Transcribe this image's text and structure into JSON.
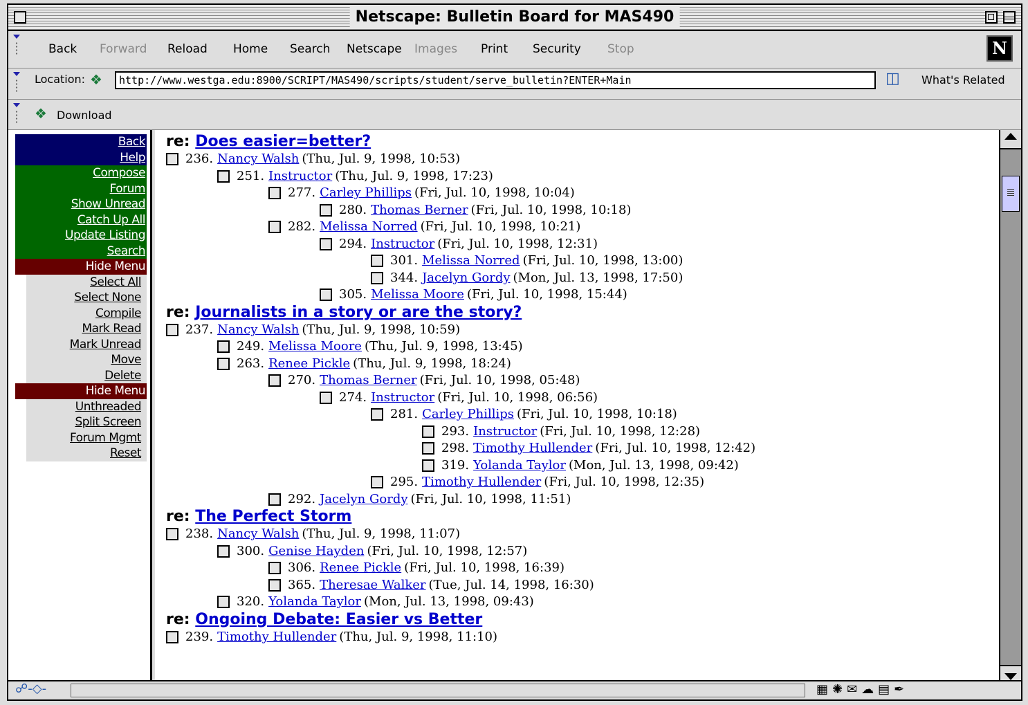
{
  "window": {
    "title": "Netscape: Bulletin Board for MAS490"
  },
  "toolbar": {
    "buttons": [
      {
        "label": "Back",
        "enabled": true
      },
      {
        "label": "Forward",
        "enabled": false
      },
      {
        "label": "Reload",
        "enabled": true
      },
      {
        "label": "Home",
        "enabled": true
      },
      {
        "label": "Search",
        "enabled": true
      },
      {
        "label": "Netscape",
        "enabled": true
      },
      {
        "label": "Images",
        "enabled": false
      },
      {
        "label": "Print",
        "enabled": true
      },
      {
        "label": "Security",
        "enabled": true
      },
      {
        "label": "Stop",
        "enabled": false
      }
    ],
    "logo": "N"
  },
  "location": {
    "label": "Location:",
    "url": "http://www.westga.edu:8900/SCRIPT/MAS490/scripts/student/serve_bulletin?ENTER+Main",
    "related_label": "What's Related"
  },
  "personal": {
    "download_label": "Download"
  },
  "sidebar": {
    "items": [
      {
        "label": "Back",
        "style": "navy"
      },
      {
        "label": "Help",
        "style": "navy"
      },
      {
        "label": "Compose",
        "style": "green"
      },
      {
        "label": "Forum",
        "style": "green"
      },
      {
        "label": "Show Unread",
        "style": "green"
      },
      {
        "label": "Catch Up All",
        "style": "green"
      },
      {
        "label": "Update Listing",
        "style": "green"
      },
      {
        "label": "Search",
        "style": "green"
      },
      {
        "label": "Hide Menu",
        "style": "maroon"
      },
      {
        "label": "Select All",
        "style": "grey"
      },
      {
        "label": "Select None",
        "style": "grey"
      },
      {
        "label": "Compile",
        "style": "grey"
      },
      {
        "label": "Mark Read",
        "style": "grey"
      },
      {
        "label": "Mark Unread",
        "style": "grey"
      },
      {
        "label": "Move",
        "style": "grey"
      },
      {
        "label": "Delete",
        "style": "grey"
      },
      {
        "label": "Hide Menu",
        "style": "maroon"
      },
      {
        "label": "Unthreaded",
        "style": "grey"
      },
      {
        "label": "Split Screen",
        "style": "grey"
      },
      {
        "label": "Forum Mgmt",
        "style": "grey"
      },
      {
        "label": "Reset",
        "style": "grey"
      }
    ]
  },
  "threads": [
    {
      "prefix": "re:",
      "title": "Does easier=better?",
      "messages": [
        {
          "level": 0,
          "num": "236.",
          "author": "Nancy Walsh",
          "date": "(Thu, Jul. 9, 1998, 10:53)"
        },
        {
          "level": 1,
          "num": "251.",
          "author": "Instructor",
          "date": "(Thu, Jul. 9, 1998, 17:23)"
        },
        {
          "level": 2,
          "num": "277.",
          "author": "Carley Phillips",
          "date": "(Fri, Jul. 10, 1998, 10:04)"
        },
        {
          "level": 3,
          "num": "280.",
          "author": "Thomas Berner",
          "date": "(Fri, Jul. 10, 1998, 10:18)"
        },
        {
          "level": 2,
          "num": "282.",
          "author": "Melissa Norred",
          "date": "(Fri, Jul. 10, 1998, 10:21)"
        },
        {
          "level": 3,
          "num": "294.",
          "author": "Instructor",
          "date": "(Fri, Jul. 10, 1998, 12:31)"
        },
        {
          "level": 4,
          "num": "301.",
          "author": "Melissa Norred",
          "date": "(Fri, Jul. 10, 1998, 13:00)"
        },
        {
          "level": 4,
          "num": "344.",
          "author": "Jacelyn Gordy",
          "date": "(Mon, Jul. 13, 1998, 17:50)"
        },
        {
          "level": 3,
          "num": "305.",
          "author": "Melissa Moore",
          "date": "(Fri, Jul. 10, 1998, 15:44)"
        }
      ]
    },
    {
      "prefix": "re:",
      "title": "Journalists in a story or are the story?",
      "messages": [
        {
          "level": 0,
          "num": "237.",
          "author": "Nancy Walsh",
          "date": "(Thu, Jul. 9, 1998, 10:59)"
        },
        {
          "level": 1,
          "num": "249.",
          "author": "Melissa Moore",
          "date": "(Thu, Jul. 9, 1998, 13:45)"
        },
        {
          "level": 1,
          "num": "263.",
          "author": "Renee Pickle",
          "date": "(Thu, Jul. 9, 1998, 18:24)"
        },
        {
          "level": 2,
          "num": "270.",
          "author": "Thomas Berner",
          "date": "(Fri, Jul. 10, 1998, 05:48)"
        },
        {
          "level": 3,
          "num": "274.",
          "author": "Instructor",
          "date": "(Fri, Jul. 10, 1998, 06:56)"
        },
        {
          "level": 4,
          "num": "281.",
          "author": "Carley Phillips",
          "date": "(Fri, Jul. 10, 1998, 10:18)"
        },
        {
          "level": 5,
          "num": "293.",
          "author": "Instructor",
          "date": "(Fri, Jul. 10, 1998, 12:28)"
        },
        {
          "level": 5,
          "num": "298.",
          "author": "Timothy Hullender",
          "date": "(Fri, Jul. 10, 1998, 12:42)"
        },
        {
          "level": 5,
          "num": "319.",
          "author": "Yolanda Taylor",
          "date": "(Mon, Jul. 13, 1998, 09:42)"
        },
        {
          "level": 4,
          "num": "295.",
          "author": "Timothy Hullender",
          "date": "(Fri, Jul. 10, 1998, 12:35)"
        },
        {
          "level": 2,
          "num": "292.",
          "author": "Jacelyn Gordy",
          "date": "(Fri, Jul. 10, 1998, 11:51)"
        }
      ]
    },
    {
      "prefix": "re:",
      "title": "The Perfect Storm",
      "messages": [
        {
          "level": 0,
          "num": "238.",
          "author": "Nancy Walsh",
          "date": "(Thu, Jul. 9, 1998, 11:07)"
        },
        {
          "level": 1,
          "num": "300.",
          "author": "Genise Hayden",
          "date": "(Fri, Jul. 10, 1998, 12:57)"
        },
        {
          "level": 2,
          "num": "306.",
          "author": "Renee Pickle",
          "date": "(Fri, Jul. 10, 1998, 16:39)"
        },
        {
          "level": 2,
          "num": "365.",
          "author": "Theresae Walker",
          "date": "(Tue, Jul. 14, 1998, 16:30)"
        },
        {
          "level": 1,
          "num": "320.",
          "author": "Yolanda Taylor",
          "date": "(Mon, Jul. 13, 1998, 09:43)"
        }
      ]
    },
    {
      "prefix": "re:",
      "title": "Ongoing Debate: Easier vs Better",
      "messages": [
        {
          "level": 0,
          "num": "239.",
          "author": "Timothy Hullender",
          "date": "(Thu, Jul. 9, 1998, 11:10)"
        }
      ]
    }
  ],
  "colors": {
    "link": "#0000cc",
    "menu_navy": "#000066",
    "menu_green": "#006600",
    "menu_maroon": "#660000"
  }
}
